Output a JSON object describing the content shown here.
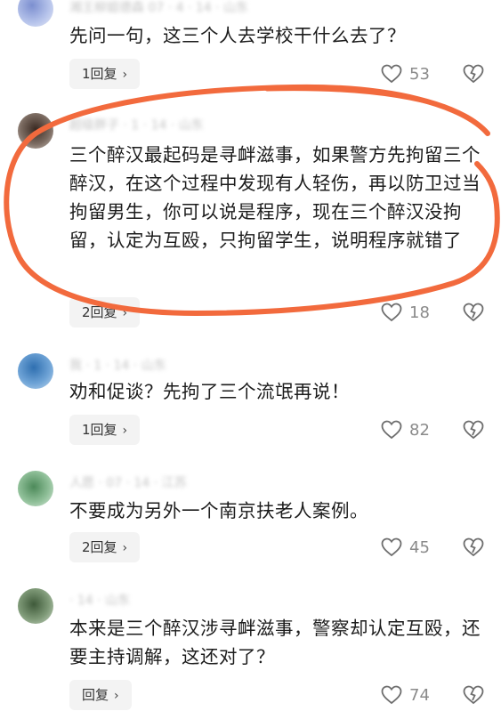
{
  "comments": [
    {
      "meta": "湘王柳姐德森 07 · 4 · 14 · 山东",
      "text": "先问一句，这三个人去学校干什么去了？",
      "reply_label": "1回复",
      "likes": "53"
    },
    {
      "meta": "超级胖子 · 1 · 14 · 山东",
      "text": "三个醉汉最起码是寻衅滋事，如果警方先拘留三个醉汉，在这个过程中发现有人轻伤，再以防卫过当拘留男生，你可以说是程序，现在三个醉汉没拘留，认定为互殴，只拘留学生，说明程序就错了",
      "reply_label": "2回复",
      "likes": "18"
    },
    {
      "meta": "我 · 1 · 14 · 山东",
      "text": "劝和促谈？先拘了三个流氓再说！",
      "reply_label": "1回复",
      "likes": "82"
    },
    {
      "meta": "人愿 · 07 · 14 · 江苏",
      "text": "不要成为另外一个南京扶老人案例。",
      "reply_label": "2回复",
      "likes": "45"
    },
    {
      "meta": "· 14 · 山东",
      "text": "本来是三个醉汉涉寻衅滋事，警察却认定互殴，还要主持调解，这还对了？",
      "reply_label": "回复",
      "likes": "74"
    }
  ],
  "icons": {
    "reply_chevron": "chevron-right-icon",
    "like": "heart-icon",
    "dislike": "broken-heart-icon"
  },
  "colors": {
    "annotation_circle": "#f26a3d",
    "count_gray": "#8a8a8a",
    "reply_bg": "#f3f3f3"
  }
}
